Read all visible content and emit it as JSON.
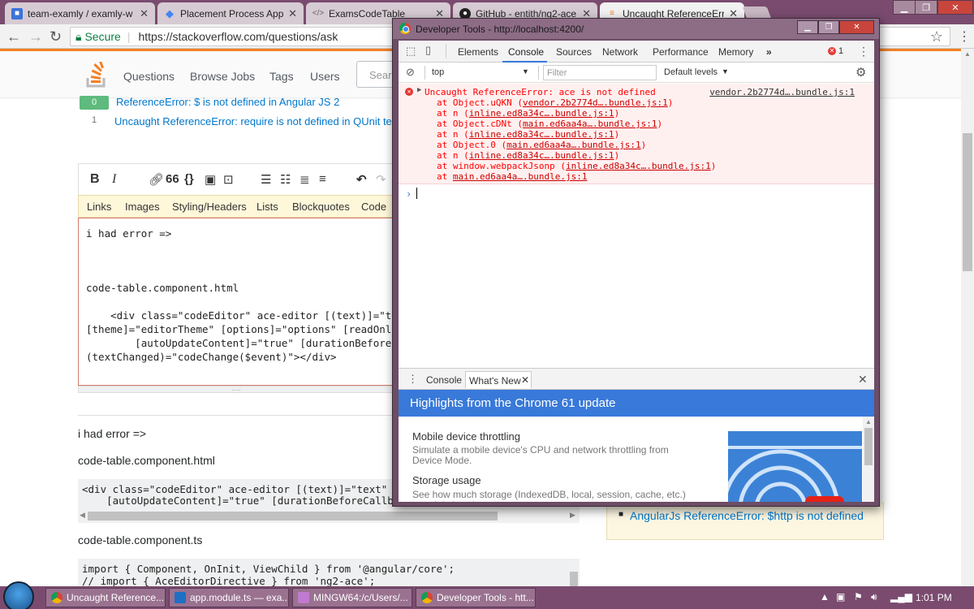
{
  "browser": {
    "tabs": [
      {
        "label": "team-examly / examly-w",
        "favicon": "box-icon",
        "color": "#3b73d9"
      },
      {
        "label": "Placement Process App -",
        "favicon": "diamond-icon",
        "color": "#4285f4"
      },
      {
        "label": "ExamsCodeTable",
        "favicon": "code-icon",
        "color": "#666666"
      },
      {
        "label": "GitHub - entith/ng2-ace",
        "favicon": "github-icon",
        "color": "#222222"
      },
      {
        "label": "Uncaught ReferenceErro",
        "favicon": "stackoverflow-icon",
        "color": "#f48024"
      }
    ],
    "secure_label": "Secure",
    "url": "https://stackoverflow.com/questions/ask"
  },
  "so": {
    "nav": [
      "Questions",
      "Browse Jobs",
      "Tags",
      "Users"
    ],
    "search_placeholder": "Sear",
    "related": [
      {
        "votes": "0",
        "title": "ReferenceError: $ is not defined in Angular JS 2"
      },
      {
        "votes": "1",
        "title": "Uncaught ReferenceError: require is not defined in QUnit test"
      }
    ],
    "toolbar": {
      "bold": "B",
      "italic": "I",
      "quote": "66",
      "code": "{}",
      "undo": "↶",
      "redo": "↷"
    },
    "help_tabs": [
      "Links",
      "Images",
      "Styling/Headers",
      "Lists",
      "Blockquotes",
      "Code"
    ],
    "editor_lines": [
      "i had error =>",
      "",
      "",
      "",
      "code-table.component.html",
      "",
      "    <div class=\"codeEditor\" ace-editor [(text)]=\"text",
      "[theme]=\"editorTheme\" [options]=\"options\" [readOnly]=",
      "        [autoUpdateContent]=\"true\" [durationBeforeCa",
      "(textChanged)=\"codeChange($event)\"></div>"
    ],
    "preview": {
      "line1": "i had error =>",
      "heading_html": "code-table.component.html",
      "code_html": [
        "<div class=\"codeEditor\" ace-editor [(text)]=\"text\" [mode]",
        "    [autoUpdateContent]=\"true\" [durationBeforeCallback]=\""
      ],
      "heading_ts": "code-table.component.ts",
      "code_ts": [
        "import { Component, OnInit, ViewChild } from '@angular/core';",
        "// import { AceEditorDirective } from 'ng2-ace';"
      ]
    },
    "sidebar_link": "AngularJs ReferenceError: $http is not defined"
  },
  "devtools": {
    "title": "Developer Tools - http://localhost:4200/",
    "tabs": [
      "Elements",
      "Console",
      "Sources",
      "Network",
      "Performance",
      "Memory"
    ],
    "more": "»",
    "error_count": "1",
    "context": "top",
    "filter_placeholder": "Filter",
    "levels": "Default levels",
    "error": {
      "message": "Uncaught ReferenceError: ace is not defined",
      "source": "vendor.2b2774d….bundle.js:1",
      "stack": [
        {
          "fn": "at Object.uQKN (",
          "loc": "vendor.2b2774d….bundle.js:1",
          "end": ")"
        },
        {
          "fn": "at n (",
          "loc": "inline.ed8a34c….bundle.js:1",
          "end": ")"
        },
        {
          "fn": "at Object.cDNt (",
          "loc": "main.ed6aa4a….bundle.js:1",
          "end": ")"
        },
        {
          "fn": "at n (",
          "loc": "inline.ed8a34c….bundle.js:1",
          "end": ")"
        },
        {
          "fn": "at Object.0 (",
          "loc": "main.ed6aa4a….bundle.js:1",
          "end": ")"
        },
        {
          "fn": "at n (",
          "loc": "inline.ed8a34c….bundle.js:1",
          "end": ")"
        },
        {
          "fn": "at window.webpackJsonp (",
          "loc": "inline.ed8a34c….bundle.js:1",
          "end": ")"
        },
        {
          "fn": "at ",
          "loc": "main.ed6aa4a….bundle.js:1",
          "end": ""
        }
      ]
    },
    "prompt": "›",
    "drawer_tabs": [
      "Console",
      "What's New"
    ],
    "whats_new": {
      "title": "Highlights from the Chrome 61 update",
      "items": [
        {
          "heading": "Mobile device throttling",
          "body": "Simulate a mobile device's CPU and network throttling from Device Mode."
        },
        {
          "heading": "Storage usage",
          "body": "See how much storage (IndexedDB, local, session, cache, etc.) an origin is using."
        }
      ]
    }
  },
  "taskbar": {
    "items": [
      {
        "label": "Uncaught Reference...",
        "icon_color": "#f4b400"
      },
      {
        "label": "app.module.ts — exa...",
        "icon_color": "#1f6fc5"
      },
      {
        "label": "MINGW64:/c/Users/...",
        "icon_color": "#c07ad0"
      },
      {
        "label": "Developer Tools - htt...",
        "icon_color": "#0f9d58"
      }
    ],
    "clock": "1:01 PM"
  }
}
